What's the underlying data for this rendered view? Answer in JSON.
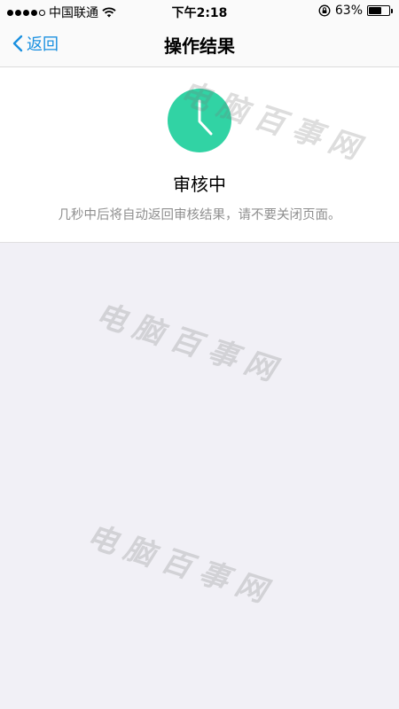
{
  "status_bar": {
    "carrier": "中国联通",
    "time": "下午2:18",
    "battery_percent_text": "63%",
    "battery_level": 0.63,
    "signal_bars_filled": 4,
    "signal_bars_total": 5
  },
  "nav": {
    "back_label": "返回",
    "title": "操作结果"
  },
  "result": {
    "status_title": "审核中",
    "description": "几秒中后将自动返回审核结果，请不要关闭页面。",
    "icon_color": "#31d3a4"
  },
  "watermark": {
    "text": "电脑百事网"
  },
  "colors": {
    "accent": "#1a90e0",
    "background": "#f1f0f6"
  }
}
